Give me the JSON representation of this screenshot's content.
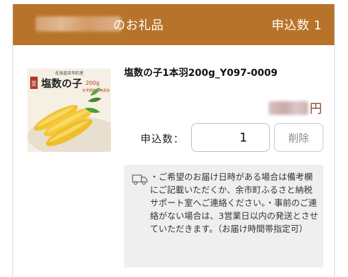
{
  "header": {
    "suffix": "のお礼品",
    "count_text": "申込数 1"
  },
  "item": {
    "title": "塩数の子1本羽200g_Y097-0009",
    "price_unit": "円",
    "image": {
      "top_text": "北海道余市町産",
      "badge_text": "至",
      "brand_text": "塩数の子",
      "weight_text": "200g",
      "sub_text": "化学調味料無添加"
    },
    "quantity_label": "申込数：",
    "quantity_value": "1",
    "delete_label": "削除"
  },
  "notice": {
    "icon": "truck-icon",
    "text": "・ご希望のお届け日時がある場合は備考欄にご記載いただくか、余市町ふるさと納税サポート室へご連絡ください。・事前のご連絡がない場合は、3営業日以内の発送とさせていただきます。（お届け時間帯指定可）"
  },
  "colors": {
    "header_bg": "#b8732a",
    "notice_bg": "#efefef"
  }
}
